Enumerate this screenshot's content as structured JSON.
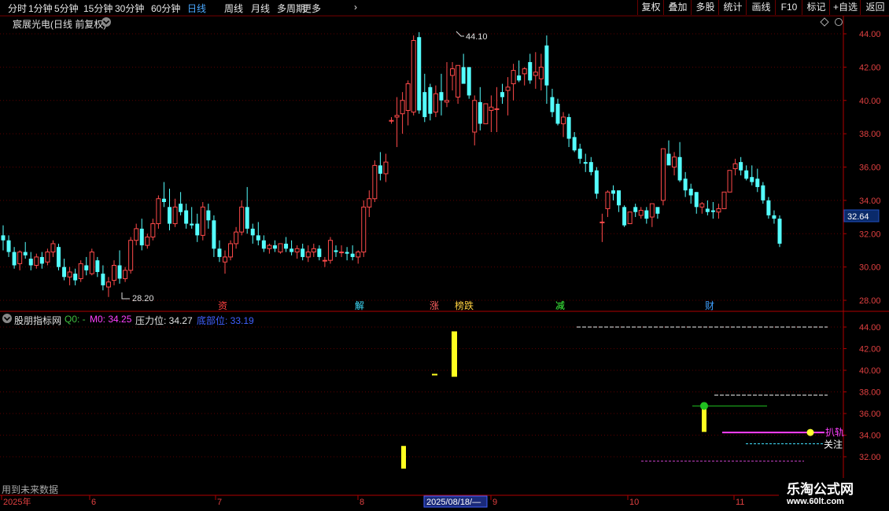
{
  "toolbar": {
    "periods": [
      "分时",
      "1分钟",
      "5分钟",
      "15分钟",
      "30分钟",
      "60分钟",
      "日线",
      "周线",
      "月线",
      "多周期",
      "更多"
    ],
    "active_period": "日线",
    "buttons": [
      "复权",
      "叠加",
      "多股",
      "统计",
      "画线",
      "F10",
      "标记",
      "+自选",
      "返回"
    ]
  },
  "main": {
    "title": "宸展光电(日线 前复权)",
    "current_price": "32.64",
    "high_label": "44.10",
    "low_label": "28.20",
    "y_ticks": [
      "44.00",
      "42.00",
      "40.00",
      "38.00",
      "36.00",
      "34.00",
      "32.00",
      "30.00",
      "28.00"
    ],
    "markers": [
      {
        "text": "资",
        "color": "#ff4040"
      },
      {
        "text": "解",
        "color": "#40e0ff"
      },
      {
        "text": "涨",
        "color": "#ff6060"
      },
      {
        "text": "榜跌",
        "color": "#ffd040"
      },
      {
        "text": "减",
        "color": "#40ff40"
      },
      {
        "text": "财",
        "color": "#40a0ff"
      }
    ]
  },
  "indicator": {
    "name": "股朋指标网",
    "q0_label": "Q0: -",
    "m0_label": "M0: 34.25",
    "pressure_label": "压力位: 34.27",
    "bottom_label": "底部位: 33.19",
    "y_ticks": [
      "44.00",
      "42.00",
      "40.00",
      "38.00",
      "36.00",
      "34.00",
      "32.00"
    ],
    "text_kline": "扒轨",
    "text_focus": "关注"
  },
  "footer": {
    "note": "用到未来数据",
    "dates": [
      "2025年",
      "6",
      "7",
      "8",
      "2025/08/18/—",
      "9",
      "10",
      "11"
    ]
  },
  "watermark": {
    "title": "乐淘公式网",
    "url": "www.60lt.com"
  },
  "chart_data": {
    "type": "candlestick",
    "title": "宸展光电(日线 前复权)",
    "ylim": [
      27.5,
      45.0
    ],
    "ohlc": [
      [
        31.9,
        32.5,
        31.0,
        31.6
      ],
      [
        31.6,
        31.9,
        30.6,
        30.9
      ],
      [
        30.9,
        31.2,
        29.9,
        30.1
      ],
      [
        30.2,
        31.0,
        29.8,
        30.9
      ],
      [
        30.9,
        31.5,
        30.5,
        30.7
      ],
      [
        30.5,
        30.9,
        29.8,
        30.1
      ],
      [
        30.1,
        30.8,
        29.9,
        30.6
      ],
      [
        30.6,
        30.9,
        29.9,
        30.2
      ],
      [
        30.3,
        31.1,
        30.1,
        30.9
      ],
      [
        30.9,
        31.6,
        30.6,
        31.4
      ],
      [
        31.2,
        31.4,
        29.8,
        30.0
      ],
      [
        30.0,
        30.5,
        29.2,
        29.4
      ],
      [
        29.4,
        30.0,
        28.9,
        29.7
      ],
      [
        29.6,
        29.9,
        28.9,
        29.2
      ],
      [
        29.3,
        30.4,
        29.1,
        30.2
      ],
      [
        30.1,
        30.6,
        29.5,
        29.8
      ],
      [
        29.6,
        31.1,
        29.5,
        30.9
      ],
      [
        30.4,
        30.6,
        29.4,
        29.7
      ],
      [
        29.6,
        30.1,
        28.6,
        28.9
      ],
      [
        28.8,
        29.4,
        28.2,
        29.1
      ],
      [
        29.2,
        30.4,
        28.9,
        30.1
      ],
      [
        30.1,
        31.0,
        29.0,
        29.3
      ],
      [
        29.3,
        30.0,
        29.1,
        29.8
      ],
      [
        29.8,
        31.8,
        29.6,
        31.6
      ],
      [
        31.6,
        32.6,
        31.3,
        32.3
      ],
      [
        32.3,
        32.9,
        31.0,
        31.3
      ],
      [
        31.3,
        32.0,
        31.1,
        31.8
      ],
      [
        31.8,
        32.9,
        31.6,
        32.6
      ],
      [
        32.6,
        34.3,
        32.3,
        34.1
      ],
      [
        34.1,
        35.1,
        33.6,
        33.9
      ],
      [
        33.6,
        34.7,
        32.2,
        32.6
      ],
      [
        32.6,
        34.1,
        32.4,
        33.6
      ],
      [
        33.8,
        34.5,
        33.1,
        33.3
      ],
      [
        33.4,
        33.8,
        32.3,
        32.6
      ],
      [
        32.6,
        33.6,
        32.3,
        32.5
      ],
      [
        32.6,
        33.2,
        31.5,
        31.9
      ],
      [
        31.9,
        33.9,
        31.6,
        33.6
      ],
      [
        33.4,
        33.8,
        32.3,
        32.8
      ],
      [
        32.8,
        33.1,
        30.6,
        31.1
      ],
      [
        31.1,
        31.6,
        30.3,
        30.6
      ],
      [
        30.3,
        31.0,
        29.6,
        30.6
      ],
      [
        30.6,
        31.6,
        30.4,
        31.4
      ],
      [
        31.4,
        32.4,
        31.1,
        32.1
      ],
      [
        32.1,
        34.0,
        31.9,
        33.6
      ],
      [
        33.6,
        34.8,
        32.0,
        32.3
      ],
      [
        32.3,
        32.6,
        31.4,
        31.9
      ],
      [
        31.9,
        32.7,
        31.3,
        31.6
      ],
      [
        31.6,
        31.9,
        30.9,
        31.1
      ],
      [
        31.1,
        31.4,
        30.8,
        31.3
      ],
      [
        31.3,
        31.6,
        30.9,
        31.1
      ],
      [
        30.9,
        31.4,
        30.8,
        31.4
      ],
      [
        31.4,
        31.8,
        30.9,
        31.1
      ],
      [
        31.1,
        31.6,
        30.7,
        30.9
      ],
      [
        30.9,
        31.3,
        30.5,
        31.1
      ],
      [
        31.1,
        31.4,
        30.4,
        30.6
      ],
      [
        30.6,
        31.3,
        30.3,
        30.9
      ],
      [
        30.9,
        31.4,
        30.6,
        31.1
      ],
      [
        31.1,
        31.3,
        30.4,
        30.6
      ],
      [
        30.4,
        30.6,
        30.0,
        30.4
      ],
      [
        30.4,
        31.8,
        30.2,
        31.6
      ],
      [
        31.0,
        31.3,
        30.6,
        30.9
      ],
      [
        30.9,
        31.3,
        30.6,
        30.9
      ],
      [
        30.9,
        31.2,
        30.4,
        30.8
      ],
      [
        30.8,
        31.3,
        30.4,
        30.6
      ],
      [
        30.6,
        31.0,
        30.2,
        30.9
      ],
      [
        30.9,
        34.0,
        30.6,
        33.6
      ],
      [
        33.6,
        34.6,
        33.0,
        34.1
      ],
      [
        34.1,
        36.4,
        33.9,
        36.1
      ],
      [
        36.1,
        36.9,
        35.2,
        35.6
      ],
      [
        35.6,
        36.8,
        35.1,
        36.3
      ],
      [
        38.8,
        39.0,
        38.6,
        38.8
      ],
      [
        39.0,
        40.2,
        37.2,
        39.1
      ],
      [
        39.2,
        40.5,
        38.0,
        40.0
      ],
      [
        39.4,
        41.2,
        38.5,
        41.0
      ],
      [
        39.3,
        43.9,
        39.1,
        43.6
      ],
      [
        43.8,
        44.1,
        39.2,
        39.4
      ],
      [
        40.5,
        41.6,
        38.7,
        39.0
      ],
      [
        40.8,
        41.0,
        38.8,
        39.2
      ],
      [
        39.3,
        40.9,
        39.0,
        40.4
      ],
      [
        40.5,
        41.6,
        39.1,
        40.0
      ],
      [
        39.9,
        42.3,
        39.6,
        40.0
      ],
      [
        41.5,
        42.3,
        40.6,
        41.9
      ],
      [
        40.2,
        41.9,
        39.8,
        42.1
      ],
      [
        42.0,
        42.8,
        41.2,
        41.0
      ],
      [
        42.0,
        41.5,
        40.1,
        40.3
      ],
      [
        38.1,
        40.3,
        37.3,
        40.0
      ],
      [
        39.9,
        40.8,
        38.2,
        38.6
      ],
      [
        38.6,
        39.6,
        38.6,
        39.8
      ],
      [
        39.4,
        40.3,
        38.1,
        39.6
      ],
      [
        39.5,
        40.8,
        38.1,
        39.5
      ],
      [
        40.5,
        41.0,
        39.8,
        40.2
      ],
      [
        40.6,
        41.4,
        39.1,
        40.8
      ],
      [
        41.0,
        42.2,
        40.0,
        41.8
      ],
      [
        41.5,
        42.4,
        41.1,
        41.2
      ],
      [
        41.6,
        42.0,
        40.9,
        41.9
      ],
      [
        42.3,
        42.8,
        41.0,
        41.2
      ],
      [
        41.5,
        42.9,
        40.7,
        41.7
      ],
      [
        41.3,
        42.8,
        40.6,
        42.0
      ],
      [
        43.3,
        43.9,
        39.8,
        40.9
      ],
      [
        40.2,
        40.7,
        39.0,
        39.3
      ],
      [
        39.8,
        40.1,
        38.5,
        38.6
      ],
      [
        38.6,
        39.3,
        37.8,
        39.0
      ],
      [
        39.0,
        39.2,
        37.2,
        37.7
      ],
      [
        37.8,
        38.1,
        36.9,
        37.0
      ],
      [
        37.1,
        37.4,
        36.2,
        36.5
      ],
      [
        36.3,
        36.8,
        35.7,
        36.2
      ],
      [
        36.3,
        36.6,
        35.5,
        35.7
      ],
      [
        35.8,
        36.0,
        34.1,
        34.4
      ],
      [
        32.7,
        33.2,
        31.5,
        32.7
      ],
      [
        33.5,
        34.6,
        33.0,
        34.5
      ],
      [
        34.6,
        34.9,
        34.0,
        34.4
      ],
      [
        34.6,
        34.5,
        33.3,
        33.7
      ],
      [
        33.6,
        33.7,
        32.4,
        32.5
      ],
      [
        32.6,
        33.2,
        32.6,
        33.3
      ],
      [
        33.6,
        33.8,
        33.0,
        33.3
      ],
      [
        33.1,
        33.6,
        32.9,
        33.4
      ],
      [
        33.4,
        33.6,
        32.6,
        32.9
      ],
      [
        33.0,
        33.8,
        32.4,
        33.8
      ],
      [
        33.6,
        33.5,
        32.9,
        33.2
      ],
      [
        34.0,
        35.2,
        33.7,
        37.1
      ],
      [
        36.8,
        37.6,
        36.3,
        36.1
      ],
      [
        36.0,
        36.9,
        35.5,
        36.6
      ],
      [
        36.6,
        37.5,
        35.1,
        35.2
      ],
      [
        35.3,
        35.7,
        34.2,
        34.6
      ],
      [
        34.7,
        35.0,
        33.8,
        34.3
      ],
      [
        34.5,
        34.5,
        33.2,
        33.6
      ],
      [
        33.6,
        33.9,
        33.2,
        33.8
      ],
      [
        33.5,
        34.0,
        33.1,
        33.3
      ],
      [
        33.4,
        33.9,
        32.9,
        33.3
      ],
      [
        33.3,
        33.8,
        32.9,
        33.5
      ],
      [
        33.5,
        34.5,
        33.6,
        34.5
      ],
      [
        34.5,
        35.8,
        34.5,
        35.8
      ],
      [
        35.9,
        36.5,
        35.5,
        36.2
      ],
      [
        36.3,
        36.6,
        35.5,
        35.8
      ],
      [
        35.8,
        36.1,
        35.2,
        35.3
      ],
      [
        35.4,
        36.1,
        34.9,
        35.1
      ],
      [
        35.3,
        35.9,
        34.5,
        34.8
      ],
      [
        34.9,
        35.1,
        33.8,
        34.0
      ],
      [
        34.0,
        34.2,
        32.9,
        33.1
      ],
      [
        33.1,
        33.4,
        32.6,
        32.9
      ],
      [
        32.9,
        33.1,
        31.2,
        31.4
      ]
    ]
  }
}
